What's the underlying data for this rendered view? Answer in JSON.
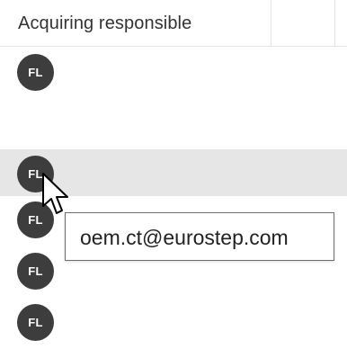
{
  "header": {
    "column_title": "Acquiring responsible"
  },
  "rows": [
    {
      "initials": "FL"
    },
    {
      "initials": "FL"
    },
    {
      "initials": "FL"
    },
    {
      "initials": "FL"
    },
    {
      "initials": "FL"
    }
  ],
  "tooltip": {
    "text": "oem.ct@eurostep.com"
  },
  "colors": {
    "avatar_bg": "#3d3d3d",
    "hover_row_bg": "#e6e6e6",
    "header_text": "#333333"
  },
  "icons": {
    "cursor": "mouse-pointer-icon"
  }
}
